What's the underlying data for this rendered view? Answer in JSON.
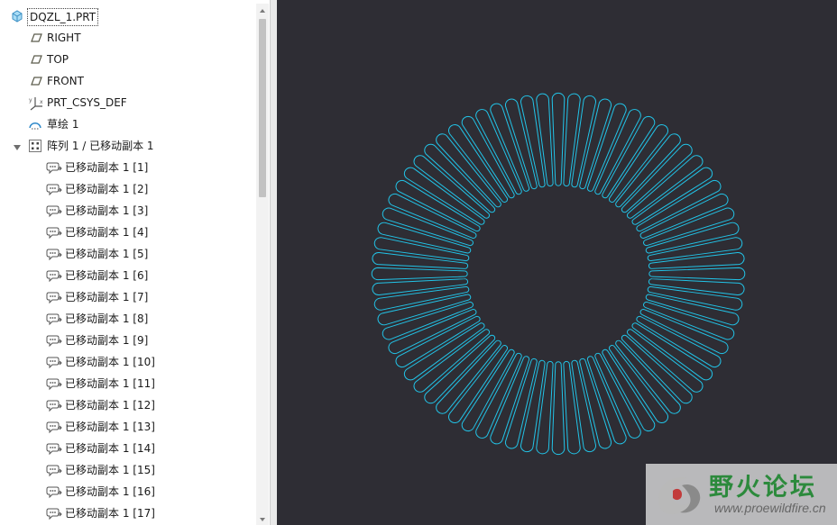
{
  "model_tree": {
    "root": {
      "label": "DQZL_1.PRT",
      "icon": "part-cube-icon"
    },
    "items": [
      {
        "label": "RIGHT",
        "icon": "datum-plane-icon"
      },
      {
        "label": "TOP",
        "icon": "datum-plane-icon"
      },
      {
        "label": "FRONT",
        "icon": "datum-plane-icon"
      },
      {
        "label": "PRT_CSYS_DEF",
        "icon": "coordinate-system-icon"
      },
      {
        "label": "草绘 1",
        "icon": "sketch-icon"
      }
    ],
    "pattern": {
      "label": "阵列 1 / 已移动副本 1",
      "icon": "pattern-icon",
      "expanded": true
    },
    "children": [
      "已移动副本 1 [1]",
      "已移动副本 1 [2]",
      "已移动副本 1 [3]",
      "已移动副本 1 [4]",
      "已移动副本 1 [5]",
      "已移动副本 1 [6]",
      "已移动副本 1 [7]",
      "已移动副本 1 [8]",
      "已移动副本 1 [9]",
      "已移动副本 1 [10]",
      "已移动副本 1 [11]",
      "已移动副本 1 [12]",
      "已移动副本 1 [13]",
      "已移动副本 1 [14]",
      "已移动副本 1 [15]",
      "已移动副本 1 [16]",
      "已移动副本 1 [17]"
    ],
    "child_icon": "moved-copy-icon"
  },
  "viewport": {
    "background": "#2e2d34",
    "curve_color": "#22c4e8",
    "slot_count": 72
  },
  "watermark": {
    "title": "野火论坛",
    "url": "www.proewildfire.cn"
  }
}
